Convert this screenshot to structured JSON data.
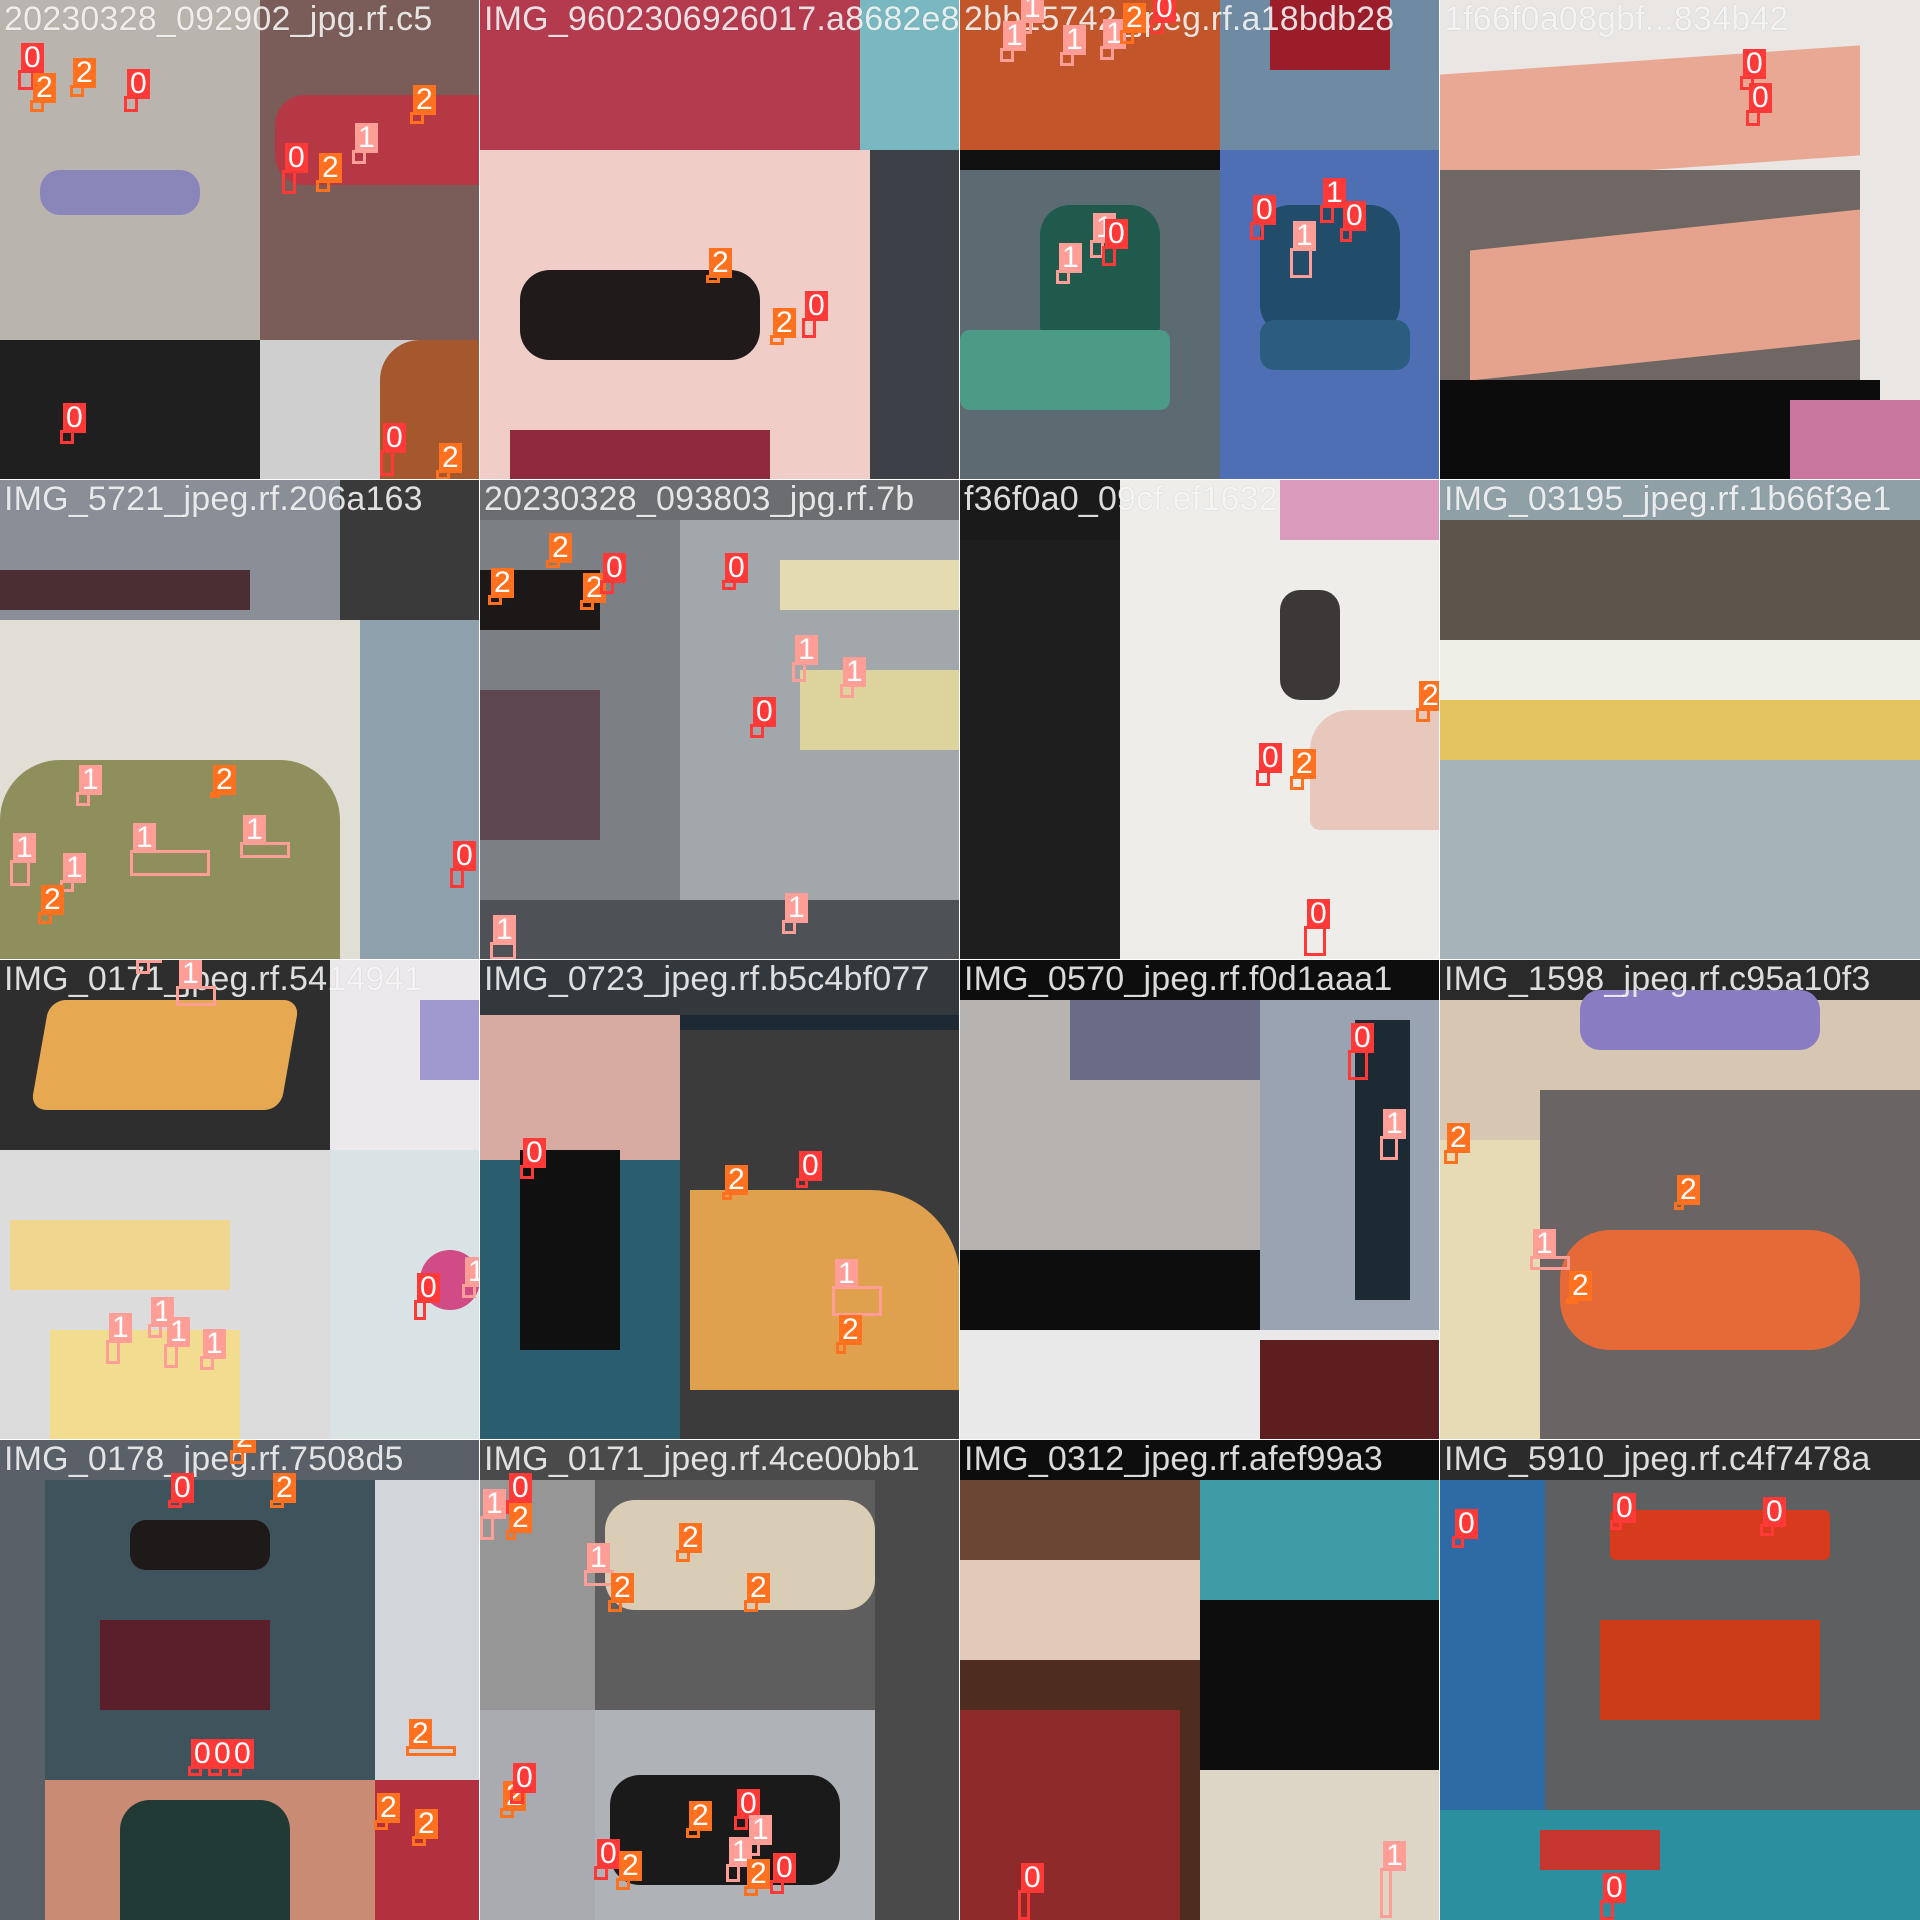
{
  "palette": {
    "class_0": "#ff3838",
    "class_1": "#ff9d97",
    "class_2": "#ff701f",
    "grid_line": "#ffffff",
    "background": "#808080"
  },
  "tiles": [
    {
      "title": "20230328_092902_jpg.rf.c5",
      "labels": [
        "0",
        "2",
        "2",
        "0",
        "2",
        "2",
        "0",
        "2",
        "1",
        "0",
        "0",
        "2"
      ]
    },
    {
      "title": "IMG_9602306926017.a8682e82",
      "labels": [
        "2",
        "2",
        "0"
      ]
    },
    {
      "title": "2bb15742_jpeg.rf.a18bdb28",
      "labels": [
        "1",
        "1",
        "1",
        "1",
        "2",
        "0",
        "1",
        "0",
        "1",
        "0",
        "0",
        "1",
        "1",
        "0"
      ]
    },
    {
      "title": "1f66f0a08gbf...834b42",
      "labels": [
        "0",
        "0"
      ]
    },
    {
      "title": "IMG_5721_jpeg.rf.206a163",
      "labels": [
        "1",
        "2",
        "1",
        "1",
        "1",
        "1",
        "2",
        "0"
      ]
    },
    {
      "title": "20230328_093803_jpg.rf.7b",
      "labels": [
        "2",
        "2",
        "2",
        "0",
        "0",
        "1",
        "1",
        "0",
        "1",
        "1"
      ]
    },
    {
      "title": "f36f0a0_09cf.ef1632",
      "labels": [
        "0",
        "2",
        "2",
        "0"
      ]
    },
    {
      "title": "IMG_03195_jpeg.rf.1b66f3e1",
      "labels": []
    },
    {
      "title": "IMG_0171_jpeg.rf.5414941",
      "labels": [
        "1",
        "1",
        "1",
        "1",
        "1",
        "1",
        "0",
        "1"
      ]
    },
    {
      "title": "IMG_0723_jpeg.rf.b5c4bf077",
      "labels": [
        "0",
        "2",
        "0",
        "1",
        "2"
      ]
    },
    {
      "title": "IMG_0570_jpeg.rf.f0d1aaa1",
      "labels": [
        "0",
        "1",
        "2",
        "0"
      ]
    },
    {
      "title": "IMG_1598_jpeg.rf.c95a10f3",
      "labels": [
        "2",
        "1",
        "2",
        "2"
      ]
    },
    {
      "title": "IMG_0178_jpeg.rf.7508d5",
      "labels": [
        "2",
        "0",
        "2",
        "0",
        "0",
        "0",
        "0",
        "2",
        "2",
        "2"
      ]
    },
    {
      "title": "IMG_0171_jpeg.rf.4ce00bb1",
      "labels": [
        "1",
        "0",
        "2",
        "0",
        "1",
        "2",
        "2",
        "2",
        "2",
        "0",
        "2",
        "0",
        "1",
        "1",
        "2",
        "0",
        "0",
        "2"
      ]
    },
    {
      "title": "IMG_0312_jpeg.rf.afef99a3",
      "labels": [
        "0",
        "1"
      ]
    },
    {
      "title": "IMG_5910_jpeg.rf.c4f7478a",
      "labels": [
        "0",
        "0",
        "0",
        "0"
      ]
    }
  ]
}
